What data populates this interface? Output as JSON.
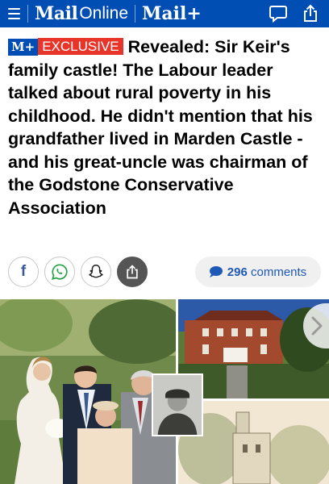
{
  "header": {
    "logo_mail": "Mail",
    "logo_online": "Online",
    "logo_mailplus": "Mail+"
  },
  "article": {
    "badge_brand": "M+",
    "badge_label": "EXCLUSIVE",
    "headline": "Revealed: Sir Keir's family castle! The Labour leader talked about rural poverty in his childhood. He didn't mention that his grandfather lived in Marden Castle - and his great-uncle was chairman of the Godstone Conservative Association"
  },
  "share": {
    "comments_count": "296",
    "comments_label": "comments"
  },
  "colors": {
    "brand_blue": "#004db3",
    "exclusive_red": "#e8352a",
    "comments_blue": "#1f59b8"
  }
}
